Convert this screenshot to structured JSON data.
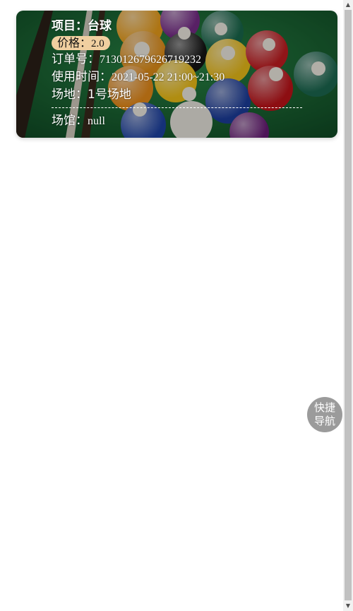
{
  "order": {
    "project_label": "项目：",
    "project_value": "台球",
    "price_label": "价格：",
    "price_value": "2.0",
    "order_no_label": "订单号：",
    "order_no_value": "713012679626719232",
    "time_label": "使用时间：",
    "time_value": "2021-05-22 21:00~21:30",
    "court_label": "场地：",
    "court_value": "1号场地",
    "venue_label": "场馆：",
    "venue_value": "null"
  },
  "quick_nav": {
    "line1": "快捷",
    "line2": "导航"
  },
  "colors": {
    "felt": "#1f6e3a",
    "badge": "#f0cfa0",
    "quick_nav": "#9b9b9b"
  },
  "scrollbar": {
    "up_icon": "triangle-up-icon",
    "down_icon": "triangle-down-icon"
  }
}
